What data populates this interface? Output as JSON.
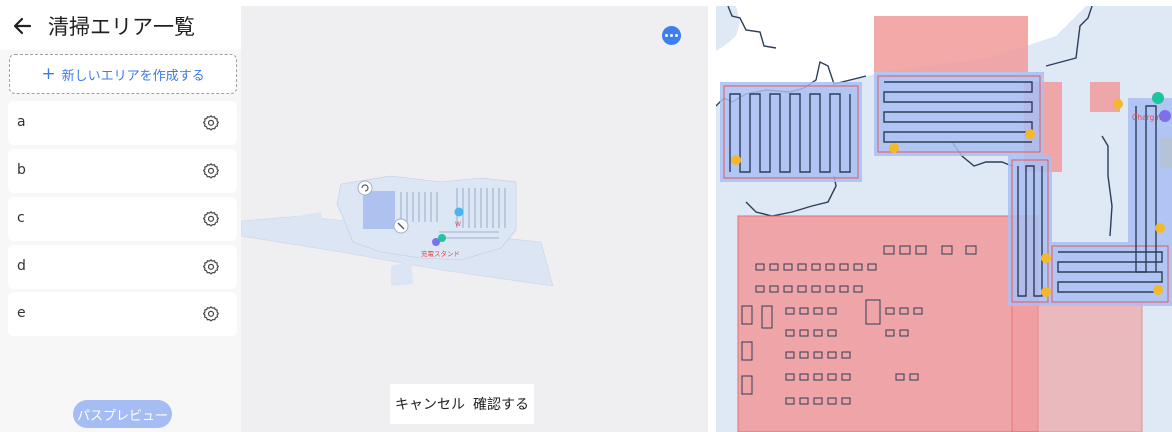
{
  "header": {
    "title": "清掃エリア一覧",
    "back_icon": "arrow-left-icon"
  },
  "create_button": {
    "icon": "plus-icon",
    "label": "新しいエリアを作成する"
  },
  "areas": [
    {
      "name": "a",
      "icon": "gear-icon"
    },
    {
      "name": "b",
      "icon": "gear-icon"
    },
    {
      "name": "c",
      "icon": "gear-icon"
    },
    {
      "name": "d",
      "icon": "gear-icon"
    },
    {
      "name": "e",
      "icon": "gear-icon"
    }
  ],
  "preview_button": {
    "label": "パスプレビュー"
  },
  "map_view": {
    "more_icon": "more-horizontal-icon",
    "charging_label": "充電スタンド",
    "marker_label": "W"
  },
  "actions": {
    "cancel": "キャンセル",
    "confirm": "確認する"
  },
  "detail_map": {
    "charging_label": "Chargin"
  },
  "colors": {
    "accent": "#3b7ff3",
    "zone_red": "#f29a9a",
    "path_blue": "#a9bff5",
    "map_floor": "#dfe8f5"
  }
}
